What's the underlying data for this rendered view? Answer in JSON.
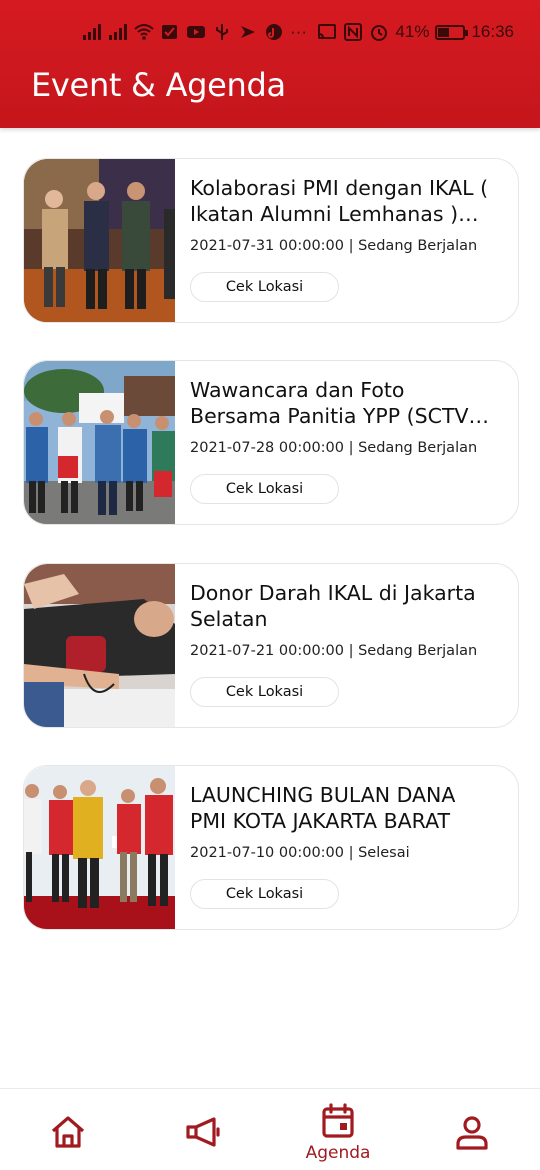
{
  "statusbar": {
    "battery_percent": "41%",
    "time": "16:36",
    "more": "···"
  },
  "header": {
    "title": "Event & Agenda"
  },
  "events": [
    {
      "title": "Kolaborasi PMI dengan IKAL ( Ikatan Alumni Lemhanas ) un...",
      "meta": "2021-07-31 00:00:00 | Sedang Berjalan",
      "button": "Cek Lokasi"
    },
    {
      "title": "Wawancara dan Foto Bersama Panitia YPP (SCTV) memberik...",
      "meta": "2021-07-28 00:00:00 | Sedang Berjalan",
      "button": "Cek Lokasi"
    },
    {
      "title": "Donor Darah IKAL di Jakarta Selatan",
      "meta": "2021-07-21 00:00:00 | Sedang Berjalan",
      "button": "Cek Lokasi"
    },
    {
      "title": "LAUNCHING BULAN DANA PMI KOTA JAKARTA BARAT",
      "meta": "2021-07-10 00:00:00 | Selesai",
      "button": "Cek Lokasi"
    }
  ],
  "nav": {
    "active_label": "Agenda",
    "accent": "#a11a20"
  },
  "colors": {
    "header": "#d61a21",
    "accent": "#a11a20"
  }
}
